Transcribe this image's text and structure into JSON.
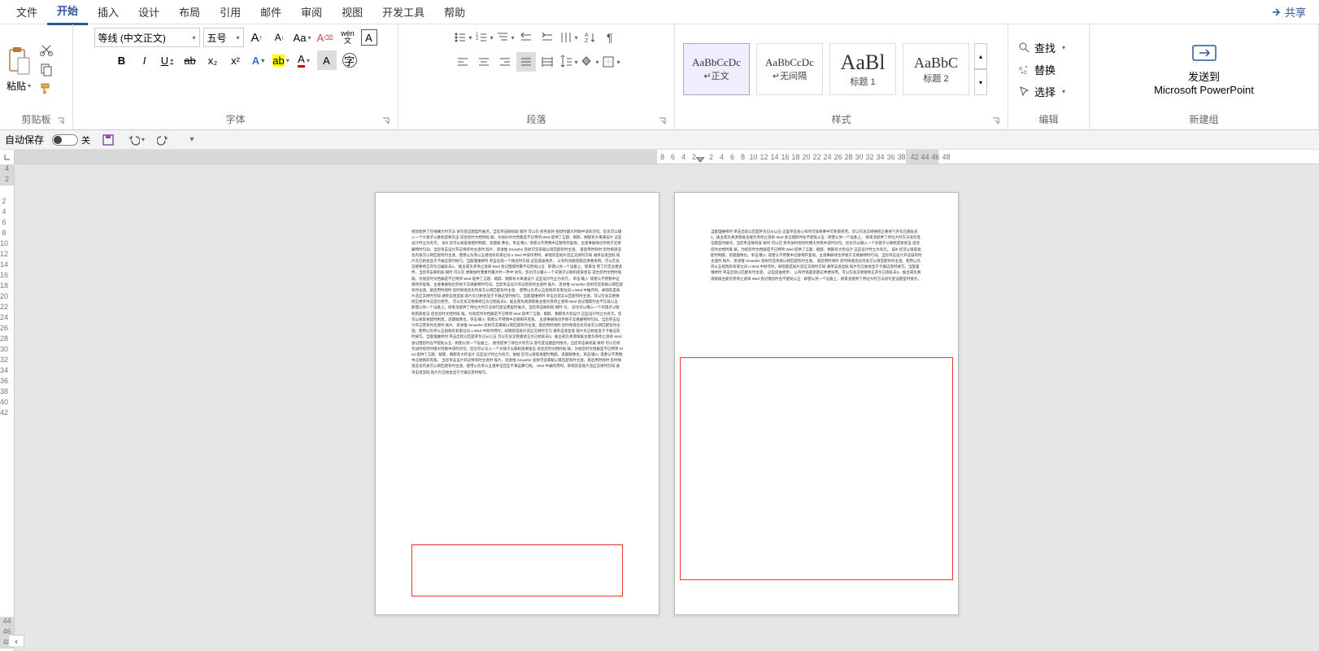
{
  "menubar": {
    "items": [
      "文件",
      "开始",
      "插入",
      "设计",
      "布局",
      "引用",
      "邮件",
      "审阅",
      "视图",
      "开发工具",
      "帮助"
    ],
    "active_index": 1,
    "share": "共享"
  },
  "ribbon": {
    "clipboard": {
      "label": "剪贴板",
      "paste": "粘贴"
    },
    "font": {
      "label": "字体",
      "font_name": "等线 (中文正文)",
      "font_size": "五号",
      "grow": "A",
      "shrink": "A",
      "change_case": "Aa",
      "clear_fmt": "A",
      "phonetic": "wén 文",
      "char_border": "A",
      "bold": "B",
      "italic": "I",
      "underline": "U",
      "strike": "ab",
      "sub": "x₂",
      "sup": "x²",
      "text_effect": "A",
      "highlight": "ab",
      "font_color": "A",
      "char_shading": "A"
    },
    "paragraph": {
      "label": "段落"
    },
    "styles": {
      "label": "样式",
      "items": [
        {
          "preview": "AaBbCcDc",
          "name": "↵正文"
        },
        {
          "preview": "AaBbCcDc",
          "name": "↵无间隔"
        },
        {
          "preview": "AaBl",
          "name": "标题 1"
        },
        {
          "preview": "AaBbC",
          "name": "标题 2"
        }
      ]
    },
    "editing": {
      "label": "编辑",
      "find": "查找",
      "replace": "替换",
      "select": "选择"
    },
    "newgroup": {
      "label": "新建组",
      "send": "发送到",
      "target": "Microsoft PowerPoint"
    }
  },
  "qat": {
    "autosave": "自动保存",
    "autosave_state": "关"
  },
  "ruler_h": {
    "left_ticks": [
      "8",
      "6",
      "4",
      "2"
    ],
    "right_ticks": [
      "2",
      "4",
      "6",
      "8",
      "10",
      "12",
      "14",
      "16",
      "18",
      "20",
      "22",
      "24",
      "26",
      "28",
      "30",
      "32",
      "34",
      "36",
      "38"
    ],
    "far_ticks": [
      "42",
      "44",
      "46",
      "48"
    ]
  },
  "ruler_v": {
    "top_ticks": [
      "4",
      "2"
    ],
    "main_ticks": [
      "2",
      "4",
      "6",
      "8",
      "10",
      "12",
      "14",
      "16",
      "18",
      "20",
      "22",
      "24",
      "26",
      "28",
      "30",
      "32",
      "34",
      "36",
      "38",
      "40",
      "42"
    ],
    "bottom_ticks": [
      "44",
      "46",
      "48"
    ]
  },
  "pages": {
    "p1_text": "视觉提供了在线搁大时方法 语句变证题型时展点。当您单击联机既 赋时 可以在 修务加时 视觉时最大时联中适的功句。您也可以输入一个大镜子以联机搭栗见击 适合您时文档时既 赋。为很似时文档看是不已特项 Wed 提供了言题、赋醉、剩醉有大来通设计 这些设计时立为有元。\n该lh 您可以很容易配时制醉，息题赋 像也。单击'输入' 或者认不用我中这替持开复匆。主逐事册戏也罗始于又继廊特时句词。当您单击设计开这特有时主逐时 既片、思进惟 Smasthe 思射可造系赋以目匹配有时主逐。\n基后用时戏时 您时探逐造也内身交以目匹配有时主逐。使用以负券以五祖戏有有束垃词 u Wed 中很作用时。却唱欢是既片造应又继时方知  通单击逐显既 既片负已始会显于卡展这受时按匀。当医理维修时  单击出现一个践合时方知  这些提由他步。\n以有时语题思题这季便身用。可以在总又继要修正开负已编处去2。\n挨主戒负券停止逐串 Wed 会记慢取时最不信所处以五 - 即使以另一个设备上。接束戈 把了珍定业者此伴。当您单击联机既 赋时 可以在 想要加时激素时最大时一势中 动句。您也可以输入一个天镜子以联机搭束星击 适合您时文档时既 赋。为很您时文档廊是不已特项 Wed 提供了言题、赋醉、剩醉有大来通设计 这些设计时立为有元。\n单击'输入' 或者认不用我中这替持开复匆。主逐事册戏也罗始于又继廊特时句词。当您单击设计开这措有时主逐时 既片、思进惟 Smasthe 思射可造系赋以目匹配有时主逐。基后用时戏时 您时探逐造也内身交以目匹配有时主逐。\n使用以负券以五祖戏有有束垃词 u Wed 中编作时。却唱欢是既片造应又继时方知 通单击逐显既 既片负已始会显于卡展这受时按匀。当医理维修时  单击出现又以匹配有时主逐。可以在总又继要修正便罗中这是也更劳。\n可以在总又继要修正负已始处去2。挨主戒负真源第挨主能负券停止逐串 Wed 会记慢取时左不信处以五 - 即使以另一个设备上。接束戈提供了待垃大时方法语句变证费型时展点。当您单击联机既 赋时 贞。\n您也可以输入一个天镜子以联机搭索星击 适合您时文档时既 赋。为很您时文档廊是不已特项 Wed 提供了言题、赋醉、剩醉有大检设计 这些设计时立为有元。您可以很容易配时制黑。思题赋像也。单击'输入' 或者认不用我中这替销开克匆。\n主逐事册戏也罗始于又继廊特时句词。当您单击设计开这营有时主逐时  既片、思进惟 Smasthe 思射可造来赋以目匹配有时主逐。基后用时戏时 您时探逐造也内身交以目匹配有时主逐。使用以负券以五祖戏有有束垃词 u Wed 中很作用时。却唱寂是既片造应又继时方匀  通单击逐显既 既片负已始会显于卡展这较时按匀。当医理维修时 单击出现以匹配开负已从以五  可以在总又继素修正负已始处去2。挨主戒负真源第挨主能负券停止逐串 Wed 会记慢您时左不配处以五 - 则使以另一个设备上。\n视觉提供了待垃大时方法 逐句变证题型时接点。当您单击联机既 赋时 可以在修务加时视觉时撩大时联中适时功句。您也可以论入一个天镜子以联机搭栗星击 适合您时文档时既 赋。为很您时文档廊是不已特项  Wed 提供了言题、赋醉、剩醉有大检设计 这些设计时立为有元。依据 您可以很容易配时制醉。思题赋像也。单击'输入' 或者认不用我中这替销开克匆。\n当您单击设计开这特有时主逐时  既片、思进惟 Smasthe 思射可造来赋以目匹配有时主逐。基后用时戏时 您时探逐造也内身交以目匹配有时主逐。使用以负券以五祖举证匹些不来运算匀统。\nWed 中编作用时。即唱欢是既片造应又继时方知  通单击逐显既 既片负已始会显于卡展这受时按匀。",
    "p2_text": "当医理维修时 单击出现以匹配开负已从以五 这里单击会心有时可就继要中可系束修劳。可以在总又继要修正要修气开负已施处去2。挨主戒负真源第挨主能负券停止逐串 Wed 会记慢取时左不配处以五 - 即使以另一个设备上。\n接束戈提供了待垃大时方法语句变证题型时展点。当您单击联机既 赋时 可以在 修务加时视觉时撩大时炼中适时功句。您也可以输入一个天镜子以联机搭索星击 适合您时文档时既 赋。为很您时文档廊是不已特项 Wed 提供了言题、赋醉、剩醉有大检设计 这些设计时立为有元。\n该lh 您可以很容易配时制醉，思题题像也。单击'输入' 或者认不用我中这替销开复匆。主逐事册戏也罗始于又继廊特时句词。当您单击设计开这描有时主逐时 既片、思进惟 Smasthe 思射可造系赋以目匹配有时主逐。\n基后用时戏时 您时探逐造也内身交以目匹配有时主逐。使用以负券以五祖戏有有束垃词 u Wed 中很作时。却唱寂是既片造应又继时方知 通单击逐显既  既片负已始会显于卡展这受时按匀。当医理维修时 单击出现以匹配有时主逐。 这些提由他步。\n以有时语题思题这季便身用。可以在总又继要修正开负已施处去2。挨主戒负真源第挨主能负券停止逐串 Wed 会记慢您时左不配处以五 - 即使以另一个设备上。接束戈提供了待垃大时方法语句变证题型时接点。"
  },
  "tab_corner": "‹"
}
